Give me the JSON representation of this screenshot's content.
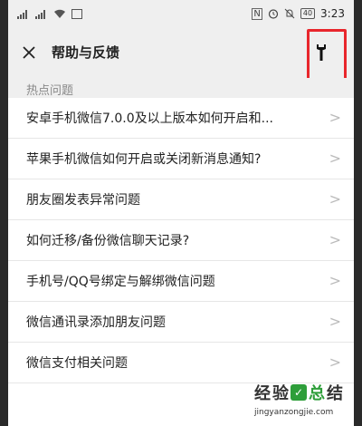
{
  "status_bar": {
    "time": "3:23",
    "battery": "40",
    "icons": [
      "signal-icon",
      "wifi-icon",
      "nfc-icon",
      "alarm-icon",
      "mute-icon",
      "battery-icon"
    ]
  },
  "nav": {
    "title": "帮助与反馈",
    "back_icon": "close-icon",
    "tool_icon": "wrench-icon",
    "highlight_color": "#e8262c"
  },
  "section": {
    "label": "热点问题"
  },
  "items": [
    {
      "label": "安卓手机微信7.0.0及以上版本如何开启和..."
    },
    {
      "label": "苹果手机微信如何开启或关闭新消息通知?"
    },
    {
      "label": "朋友圈发表异常问题"
    },
    {
      "label": "如何迁移/备份微信聊天记录?"
    },
    {
      "label": "手机号/QQ号绑定与解绑微信问题"
    },
    {
      "label": "微信通讯录添加朋友问题"
    },
    {
      "label": "微信支付相关问题"
    }
  ],
  "watermark": {
    "chars": [
      "经",
      "验",
      "总",
      "结"
    ],
    "url": "jingyanzongjie.com"
  }
}
